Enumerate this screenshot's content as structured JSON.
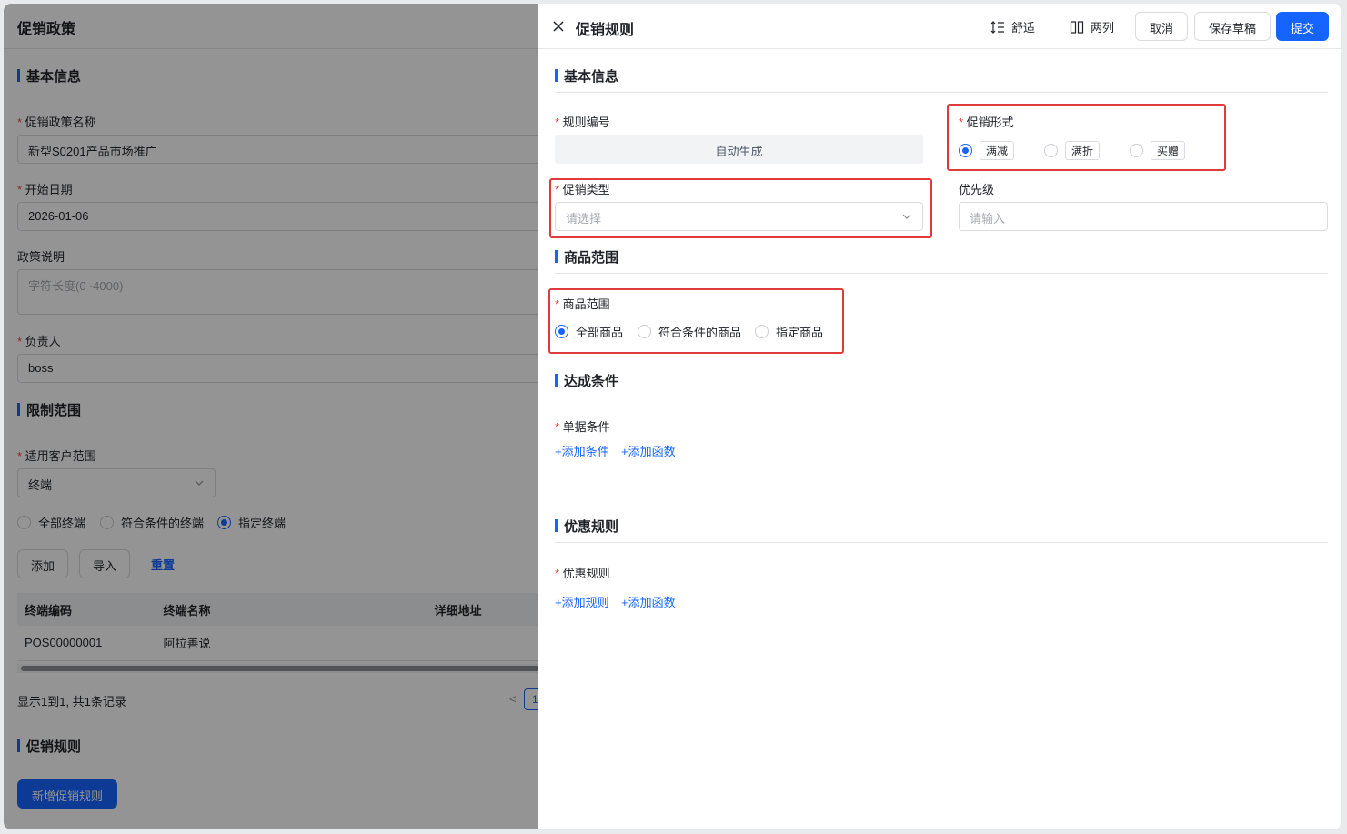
{
  "left": {
    "page_title": "促销政策",
    "sections": {
      "basic": "基本信息",
      "limit": "限制范围",
      "rules": "促销规则"
    },
    "fields": {
      "policy_name_label": "促销政策名称",
      "policy_name_value": "新型S0201产品市场推广",
      "start_date_label": "开始日期",
      "start_date_value": "2026-01-06",
      "desc_label": "政策说明",
      "desc_placeholder": "字符长度(0~4000)",
      "owner_label": "负责人",
      "owner_value": "boss",
      "customer_scope_label": "适用客户范围",
      "customer_scope_value": "终端"
    },
    "terminal_radios": [
      {
        "label": "全部终端",
        "checked": false
      },
      {
        "label": "符合条件的终端",
        "checked": false
      },
      {
        "label": "指定终端",
        "checked": true
      }
    ],
    "buttons": {
      "add": "添加",
      "import": "导入",
      "reset": "重置",
      "new_rule": "新增促销规则"
    },
    "table": {
      "headers": [
        "终端编码",
        "终端名称",
        "详细地址"
      ],
      "rows": [
        [
          "POS00000001",
          "阿拉善说",
          ""
        ]
      ]
    },
    "pagination_text": "显示1到1, 共1条记录",
    "page_no": "1"
  },
  "drawer": {
    "title": "促销规则",
    "toolbar": {
      "comfort": "舒适",
      "two_col": "两列",
      "cancel": "取消",
      "save_draft": "保存草稿",
      "submit": "提交"
    },
    "sections": {
      "basic": "基本信息",
      "goods": "商品范围",
      "condition": "达成条件",
      "discount": "优惠规则"
    },
    "fields": {
      "rule_no_label": "规则编号",
      "rule_no_value": "自动生成",
      "promo_form_label": "促销形式",
      "promo_type_label": "促销类型",
      "promo_type_placeholder": "请选择",
      "priority_label": "优先级",
      "priority_placeholder": "请输入",
      "goods_scope_label": "商品范围",
      "doc_condition_label": "单据条件",
      "discount_rule_label": "优惠规则"
    },
    "promo_form_options": [
      {
        "label": "满减",
        "checked": true
      },
      {
        "label": "满折",
        "checked": false
      },
      {
        "label": "买赠",
        "checked": false
      }
    ],
    "goods_scope_options": [
      {
        "label": "全部商品",
        "checked": true
      },
      {
        "label": "符合条件的商品",
        "checked": false
      },
      {
        "label": "指定商品",
        "checked": false
      }
    ],
    "links": {
      "add_condition": "+添加条件",
      "add_function_1": "+添加函数",
      "add_rule": "+添加规则",
      "add_function_2": "+添加函数"
    },
    "highlight_color": "#e03b3b",
    "accent_color": "#1664ff"
  }
}
